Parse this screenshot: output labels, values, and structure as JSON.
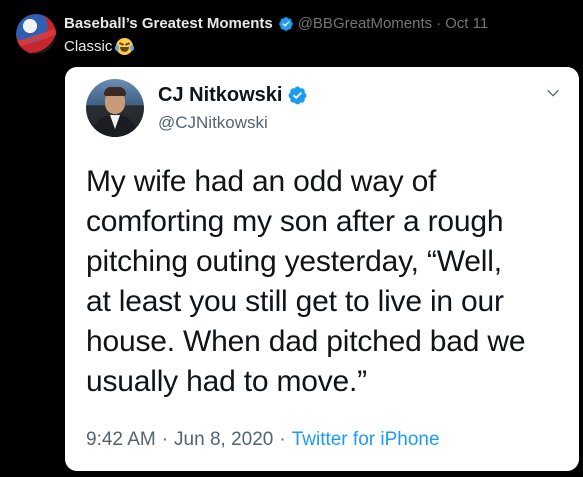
{
  "outer_tweet": {
    "author_name": "Baseball’s Greatest Moments",
    "handle": "@BBGreatMoments",
    "separator": "·",
    "time": "Oct 11",
    "text": "Classic"
  },
  "quoted_tweet": {
    "author_name": "CJ Nitkowski",
    "handle": "@CJNitkowski",
    "body_lines": [
      "My wife had an odd way of",
      "comforting my son after a rough",
      "pitching outing yesterday, “Well,",
      "at least you still get to live in our",
      "house. When dad pitched bad we",
      "usually had to move.”"
    ],
    "time": "9:42 AM",
    "date": "Jun 8, 2020",
    "separator": "·",
    "source": "Twitter for iPhone"
  },
  "icons": {
    "verified": "verified-badge-icon",
    "emoji": "face-with-tears-of-joy-icon",
    "chevron": "chevron-down-icon"
  },
  "colors": {
    "background": "#000000",
    "card": "#ffffff",
    "verified": "#1d9bf0",
    "link": "#1d9bf0",
    "muted": "#71767b"
  }
}
